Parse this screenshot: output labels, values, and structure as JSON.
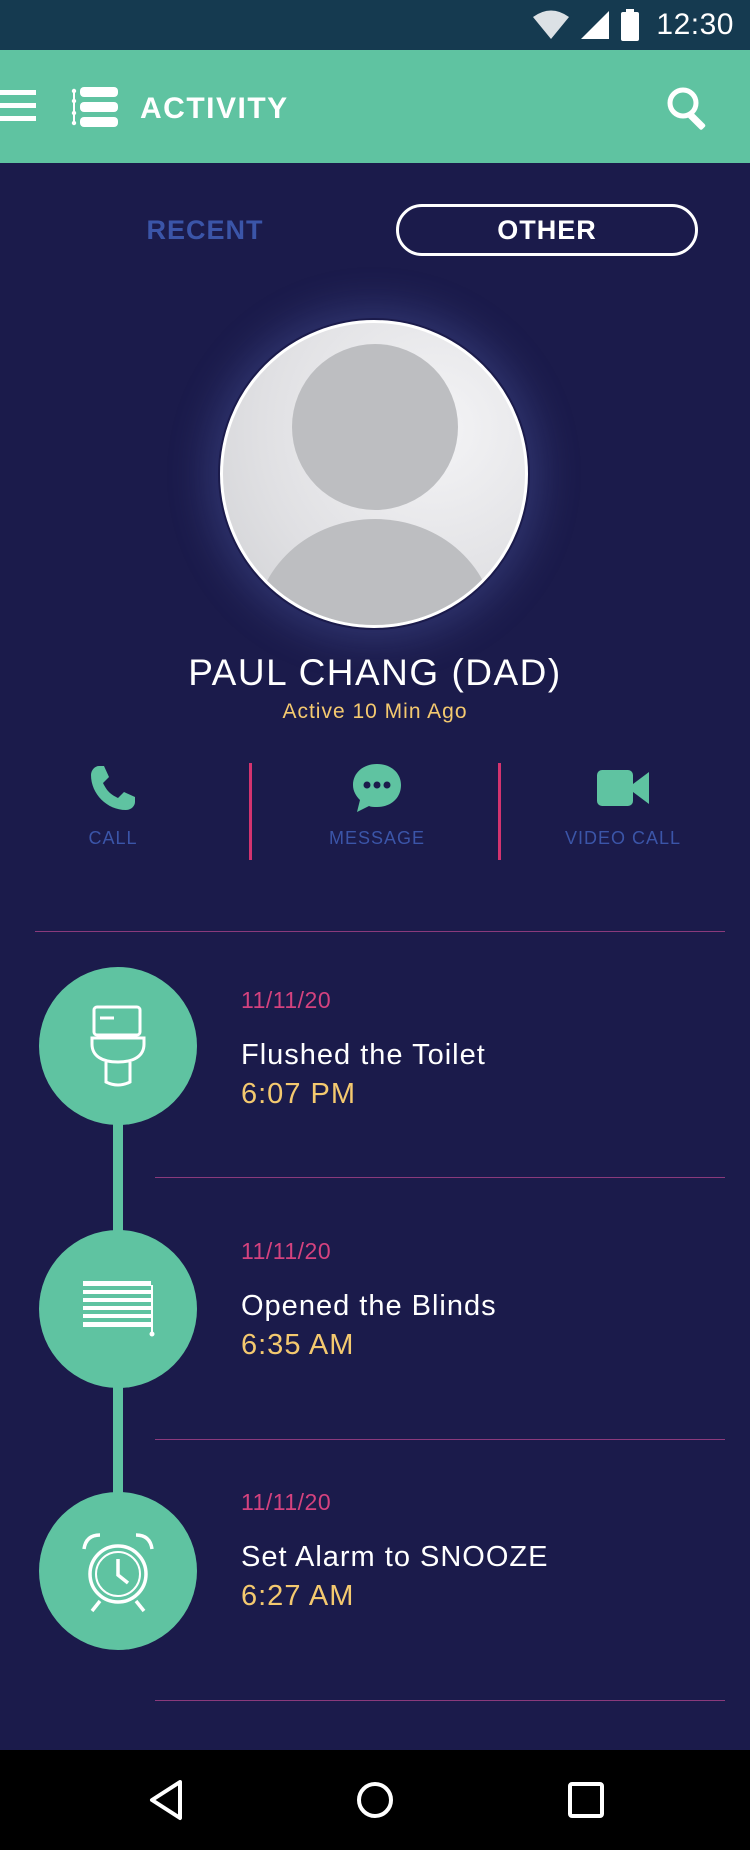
{
  "status_bar": {
    "time": "12:30",
    "icons": [
      "wifi-icon",
      "signal-icon",
      "battery-icon"
    ]
  },
  "app_bar": {
    "title": "ACTIVITY",
    "icons": [
      "menu-icon",
      "activity-list-icon",
      "search-icon"
    ]
  },
  "tabs": [
    {
      "label": "RECENT",
      "selected": false
    },
    {
      "label": "OTHER",
      "selected": true
    }
  ],
  "contact": {
    "name": "PAUL CHANG (DAD)",
    "status": "Active 10 Min Ago"
  },
  "actions": [
    {
      "label": "CALL",
      "icon": "phone-icon"
    },
    {
      "label": "MESSAGE",
      "icon": "chat-bubble-icon"
    },
    {
      "label": "VIDEO CALL",
      "icon": "video-camera-icon"
    }
  ],
  "events": [
    {
      "date": "11/11/20",
      "title": "Flushed the Toilet",
      "time": "6:07 PM",
      "icon": "toilet-icon"
    },
    {
      "date": "11/11/20",
      "title": "Opened the Blinds",
      "time": "6:35 AM",
      "icon": "blinds-icon"
    },
    {
      "date": "11/11/20",
      "title": "Set Alarm to SNOOZE",
      "time": "6:27 AM",
      "icon": "alarm-clock-icon"
    }
  ],
  "nav_bar": {
    "icons": [
      "back-icon",
      "home-icon",
      "recents-icon"
    ]
  },
  "colors": {
    "background": "#1b1b4b",
    "accent": "#5fc3a1",
    "status_bar": "#153a50",
    "date_pink": "#d4427e",
    "time_yellow": "#f4c96f",
    "label_blue": "#3b55a8",
    "divider_magenta": "#d3336f"
  }
}
